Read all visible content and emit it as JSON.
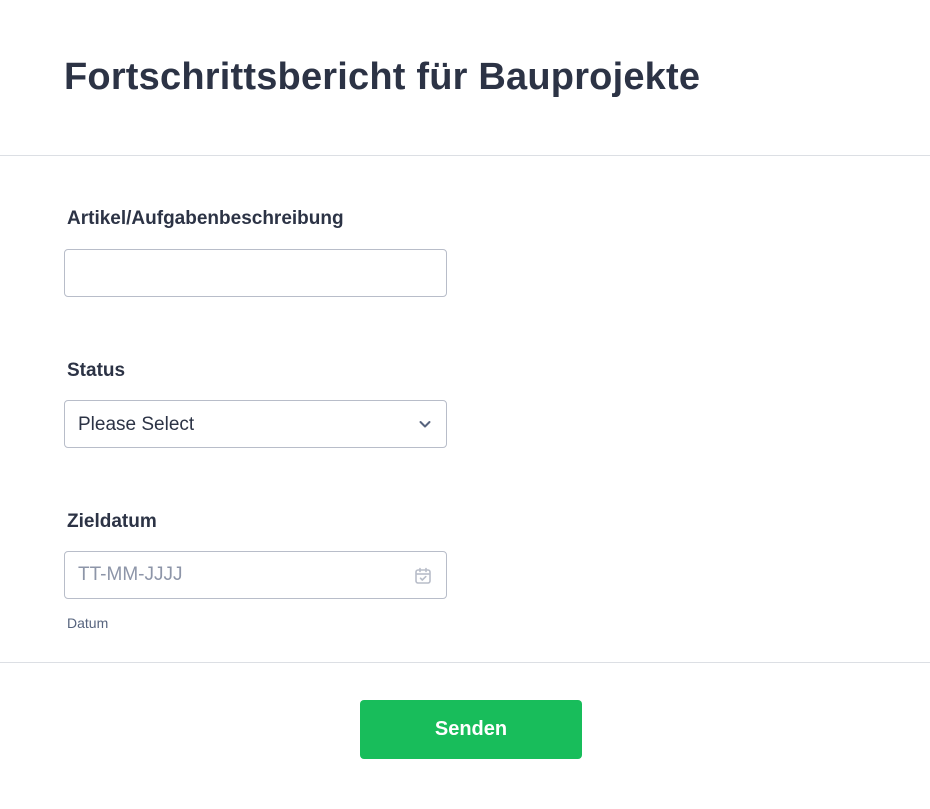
{
  "form": {
    "title": "Fortschrittsbericht für Bauprojekte"
  },
  "fields": {
    "description": {
      "label": "Artikel/Aufgabenbeschreibung",
      "value": "",
      "placeholder": ""
    },
    "status": {
      "label": "Status",
      "selected": "Please Select"
    },
    "target_date": {
      "label": "Zieldatum",
      "placeholder": "TT-MM-JJJJ",
      "value": "",
      "sublabel": "Datum"
    }
  },
  "actions": {
    "submit_label": "Senden"
  },
  "colors": {
    "title_text": "#2c3345",
    "input_border": "#b8bdc9",
    "divider": "#dcdfe4",
    "submit_bg": "#18bd5b",
    "submit_text": "#ffffff",
    "placeholder": "#8d95a8"
  },
  "icons": {
    "status_dropdown": "chevron-down-icon",
    "date_picker": "calendar-icon"
  }
}
